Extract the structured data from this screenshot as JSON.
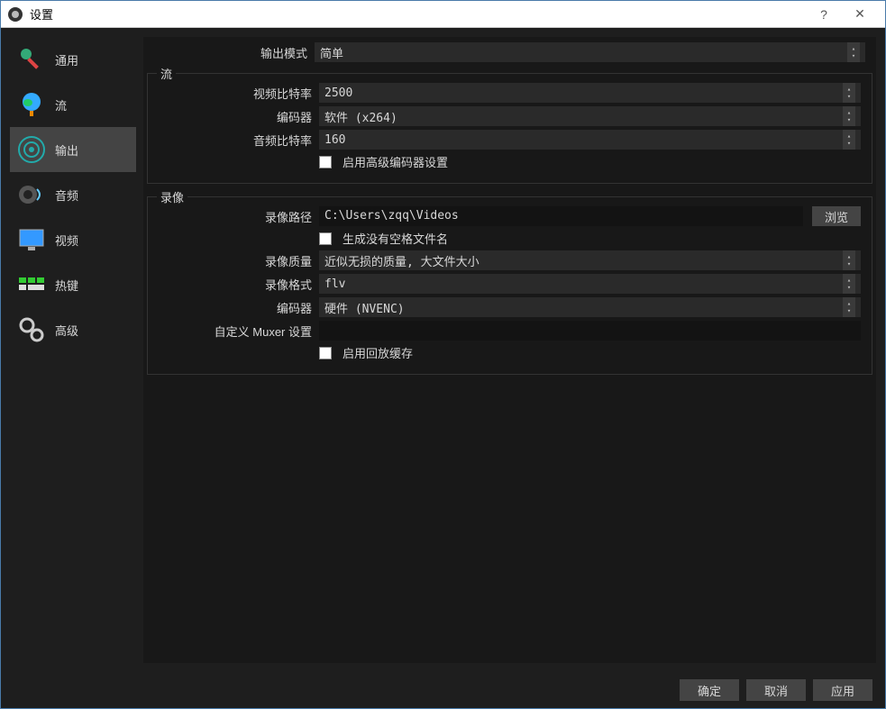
{
  "window_title": "设置",
  "sidebar": {
    "items": [
      {
        "label": "通用"
      },
      {
        "label": "流"
      },
      {
        "label": "输出"
      },
      {
        "label": "音频"
      },
      {
        "label": "视频"
      },
      {
        "label": "热键"
      },
      {
        "label": "高级"
      }
    ]
  },
  "output_mode_label": "输出模式",
  "output_mode_value": "简单",
  "stream": {
    "legend": "流",
    "bitrate_label": "视频比特率",
    "bitrate_value": "2500",
    "encoder_label": "编码器",
    "encoder_value": "软件 (x264)",
    "audio_bitrate_label": "音频比特率",
    "audio_bitrate_value": "160",
    "advanced_checkbox": "启用高级编码器设置"
  },
  "record": {
    "legend": "录像",
    "path_label": "录像路径",
    "path_value": "C:\\Users\\zqq\\Videos",
    "browse": "浏览",
    "nospace_checkbox": "生成没有空格文件名",
    "quality_label": "录像质量",
    "quality_value": "近似无损的质量, 大文件大小",
    "format_label": "录像格式",
    "format_value": "flv",
    "encoder_label": "编码器",
    "encoder_value": "硬件 (NVENC)",
    "muxer_label": "自定义 Muxer 设置",
    "muxer_value": "",
    "replay_checkbox": "启用回放缓存"
  },
  "buttons": {
    "ok": "确定",
    "cancel": "取消",
    "apply": "应用"
  }
}
